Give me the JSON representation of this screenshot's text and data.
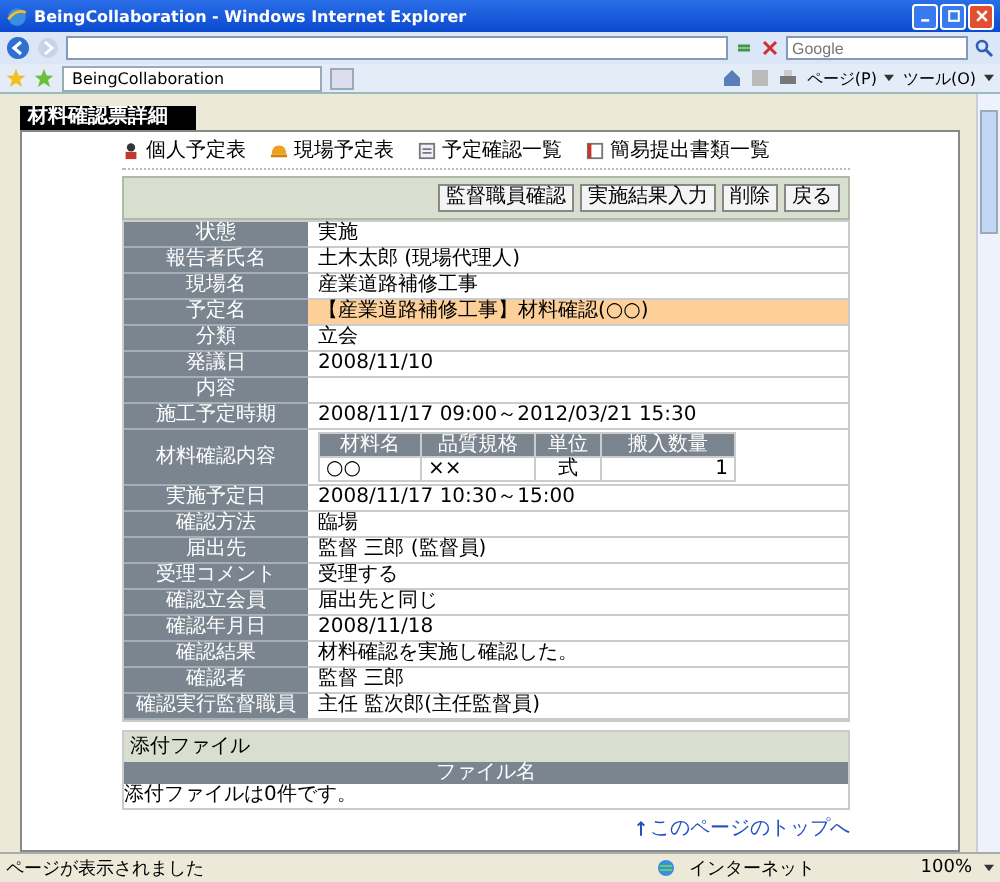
{
  "window": {
    "title": "BeingCollaboration - Windows Internet Explorer"
  },
  "toolbar": {
    "search_placeholder": "Google",
    "tab": "BeingCollaboration",
    "commands": [
      "ページ(P)",
      "ツール(O)"
    ]
  },
  "page": {
    "header_tab": "材料確認票詳細",
    "nav": [
      {
        "kind": "person",
        "label": "個人予定表"
      },
      {
        "kind": "helmet",
        "label": "現場予定表"
      },
      {
        "kind": "list",
        "label": "予定確認一覧"
      },
      {
        "kind": "document",
        "label": "簡易提出書類一覧"
      }
    ],
    "actions": [
      "監督職員確認",
      "実施結果入力",
      "削除",
      "戻る"
    ],
    "rows": [
      {
        "label": "状態",
        "value": "実施",
        "highlighted": false
      },
      {
        "label": "報告者氏名",
        "value": "土木太郎 (現場代理人)",
        "highlighted": false
      },
      {
        "label": "現場名",
        "value": "産業道路補修工事",
        "highlighted": false
      },
      {
        "label": "予定名",
        "value": "【産業道路補修工事】材料確認(○○)",
        "highlighted": true
      },
      {
        "label": "分類",
        "value": "立会",
        "highlighted": false
      },
      {
        "label": "発議日",
        "value": "2008/11/10",
        "highlighted": false
      },
      {
        "label": "内容",
        "highlighted": false
      },
      {
        "label": "施工予定時期",
        "value": "2008/11/17 09:00～2012/03/21 15:30",
        "highlighted": false
      },
      {
        "label": "材料確認内容",
        "kind": "materials",
        "highlighted": false,
        "columns": [
          "材料名",
          "品質規格",
          "単位",
          "搬入数量"
        ],
        "items": [
          [
            "○○",
            "××",
            "式",
            "1"
          ]
        ]
      },
      {
        "label": "実施予定日",
        "value": "2008/11/17 10:30～15:00",
        "highlighted": false
      },
      {
        "label": "確認方法",
        "value": "臨場",
        "highlighted": false
      },
      {
        "label": "届出先",
        "value": "監督 三郎 (監督員)",
        "highlighted": false
      },
      {
        "label": "受理コメント",
        "value": "受理する",
        "highlighted": false
      },
      {
        "label": "確認立会員",
        "value": "届出先と同じ",
        "highlighted": false
      },
      {
        "label": "確認年月日",
        "value": "2008/11/18",
        "highlighted": false
      },
      {
        "label": "確認結果",
        "value": "材料確認を実施し確認した。",
        "highlighted": false
      },
      {
        "label": "確認者",
        "value": "監督 三郎",
        "highlighted": false
      },
      {
        "label": "確認実行監督職員",
        "value": "主任 監次郎(主任監督員)",
        "highlighted": false
      }
    ],
    "attachments": {
      "title": "添付ファイル",
      "column": "ファイル名",
      "empty_message": "添付ファイルは0件です。"
    },
    "top_link": "このページのトップへ"
  },
  "status_bar": {
    "message": "ページが表示されました",
    "zone": "インターネット",
    "zoom": "100%"
  }
}
